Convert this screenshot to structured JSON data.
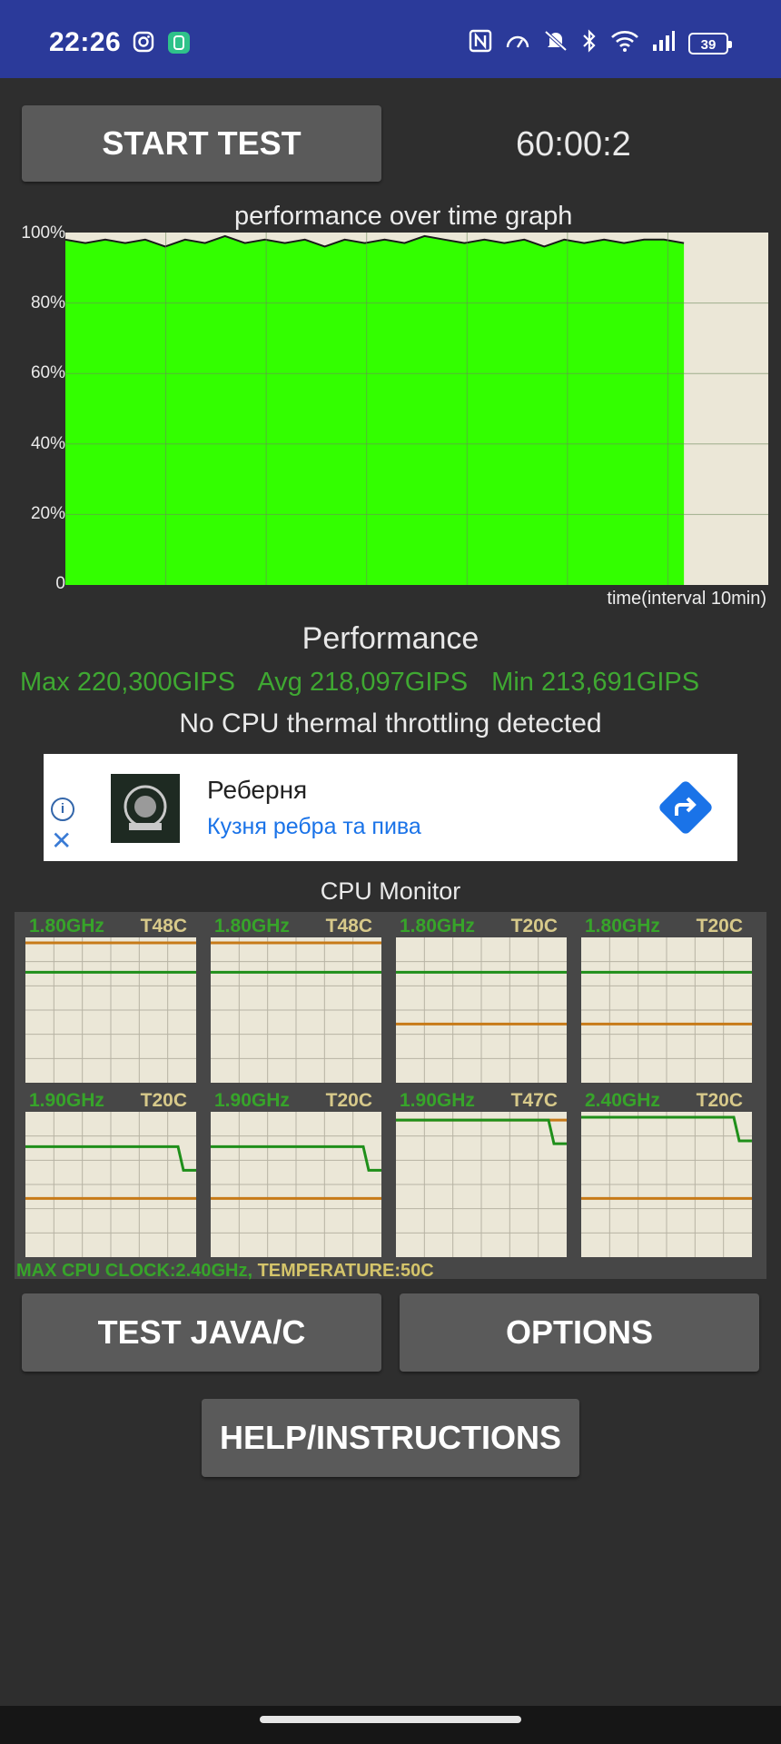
{
  "status_bar": {
    "time": "22:26",
    "left_icons": [
      "instagram-icon",
      "app-notification-icon"
    ],
    "right_icons": [
      "nfc-icon",
      "speedometer-icon",
      "mute-icon",
      "bluetooth-icon",
      "wifi-icon",
      "signal-icon"
    ],
    "battery": "39"
  },
  "controls": {
    "start_label": "START TEST",
    "timer": "60:00:2"
  },
  "perf_graph": {
    "title": "performance over time graph",
    "y_ticks": [
      "100%",
      "80%",
      "60%",
      "40%",
      "20%",
      "0"
    ],
    "x_label": "time(interval 10min)",
    "fill_color": "#33ff00",
    "chart_data": {
      "type": "area",
      "y_range": [
        0,
        100
      ],
      "x_divisions": 7,
      "filled_fraction_of_time": 0.88,
      "values_percent": [
        98,
        97,
        98,
        97,
        98,
        96,
        98,
        97,
        99,
        97,
        98,
        97,
        98,
        96,
        98,
        97,
        98,
        97,
        99,
        98,
        97,
        98,
        97,
        98,
        96,
        98,
        97,
        98,
        97,
        98,
        98,
        97
      ]
    }
  },
  "performance": {
    "title": "Performance",
    "max": "Max 220,300GIPS",
    "avg": "Avg 218,097GIPS",
    "min": "Min 213,691GIPS",
    "throttle": "No CPU thermal throttling detected"
  },
  "ad": {
    "title": "Реберня",
    "subtitle": "Кузня ребра та пива",
    "info_icon": "info-icon",
    "close_icon": "close-icon",
    "action_icon": "directions-arrow-icon"
  },
  "cpu_monitor": {
    "title": "CPU Monitor",
    "cores": [
      {
        "ghz": "1.80GHz",
        "temp": "T48C",
        "freq_level": 0.79,
        "temp_level": 1.0
      },
      {
        "ghz": "1.80GHz",
        "temp": "T48C",
        "freq_level": 0.79,
        "temp_level": 1.0
      },
      {
        "ghz": "1.80GHz",
        "temp": "T20C",
        "freq_level": 0.79,
        "temp_level": 0.42
      },
      {
        "ghz": "1.80GHz",
        "temp": "T20C",
        "freq_level": 0.79,
        "temp_level": 0.42
      },
      {
        "ghz": "1.90GHz",
        "temp": "T20C",
        "freq_level": 0.79,
        "temp_level": 0.42
      },
      {
        "ghz": "1.90GHz",
        "temp": "T20C",
        "freq_level": 0.79,
        "temp_level": 0.42
      },
      {
        "ghz": "1.90GHz",
        "temp": "T47C",
        "freq_level": 0.98,
        "temp_level": 0.98
      },
      {
        "ghz": "2.40GHz",
        "temp": "T20C",
        "freq_level": 1.0,
        "temp_level": 0.42
      }
    ],
    "footer_clock": "MAX CPU CLOCK:2.40GHz,",
    "footer_temp": " TEMPERATURE:50C"
  },
  "buttons": {
    "test_java": "TEST JAVA/C",
    "options": "OPTIONS",
    "help": "HELP/INSTRUCTIONS"
  }
}
